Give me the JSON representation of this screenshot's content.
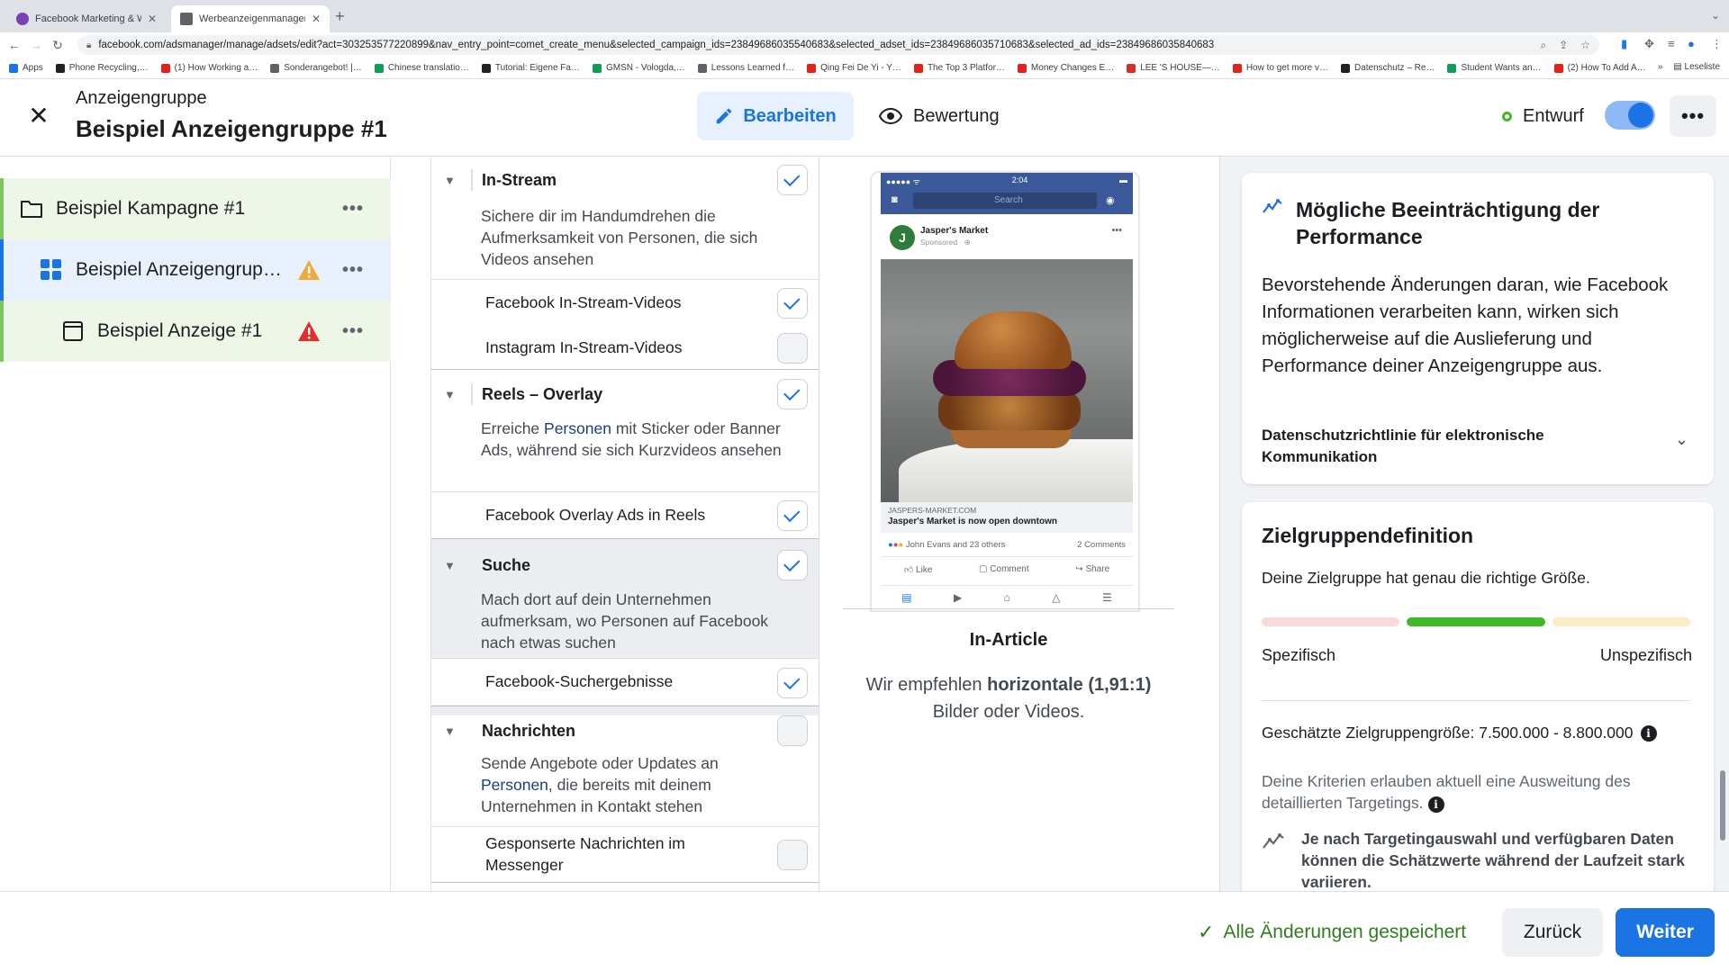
{
  "browser": {
    "tabs": [
      {
        "title": "Facebook Marketing & Werbe…",
        "active": false,
        "favicon_color": "#7b3fb7"
      },
      {
        "title": "Werbeanzeigenmanager - We…",
        "active": true,
        "favicon_color": "#5f6368"
      }
    ],
    "url": "facebook.com/adsmanager/manage/adsets/edit?act=303253577220899&nav_entry_point=comet_create_menu&selected_campaign_ids=23849686035540683&selected_adset_ids=23849686035710683&selected_ad_ids=23849686035840683",
    "bookmarks": [
      {
        "label": "Apps",
        "color": "#1a73e8"
      },
      {
        "label": "Phone Recycling,…",
        "color": "#202124"
      },
      {
        "label": "(1) How Working a…",
        "color": "#e62117"
      },
      {
        "label": "Sonderangebot! |…",
        "color": "#5f6368"
      },
      {
        "label": "Chinese translatio…",
        "color": "#0f9d58"
      },
      {
        "label": "Tutorial: Eigene Fa…",
        "color": "#202124"
      },
      {
        "label": "GMSN - Vologda,…",
        "color": "#0f9d58"
      },
      {
        "label": "Lessons Learned f…",
        "color": "#5f6368"
      },
      {
        "label": "Qing Fei De Yi - Y…",
        "color": "#e62117"
      },
      {
        "label": "The Top 3 Platfor…",
        "color": "#e62117"
      },
      {
        "label": "Money Changes E…",
        "color": "#e62117"
      },
      {
        "label": "LEE 'S HOUSE—…",
        "color": "#d93025"
      },
      {
        "label": "How to get more v…",
        "color": "#e62117"
      },
      {
        "label": "Datenschutz – Re…",
        "color": "#202124"
      },
      {
        "label": "Student Wants an…",
        "color": "#0f9d58"
      },
      {
        "label": "(2) How To Add A…",
        "color": "#e62117"
      }
    ],
    "reading_list": "Leseliste"
  },
  "header": {
    "subtitle": "Anzeigengruppe",
    "title": "Beispiel Anzeigengruppe #1",
    "edit_label": "Bearbeiten",
    "review_label": "Bewertung",
    "status_label": "Entwurf",
    "toggle_on": true
  },
  "sidebar": {
    "campaign": "Beispiel Kampagne #1",
    "adset": "Beispiel Anzeigengrup…",
    "ad": "Beispiel Anzeige #1"
  },
  "placements": {
    "instream": {
      "title": "In-Stream",
      "desc": "Sichere dir im Handumdrehen die Aufmerksamkeit von Personen, die sich Videos ansehen",
      "checked": true,
      "items": [
        {
          "label": "Facebook In-Stream-Videos",
          "checked": true
        },
        {
          "label": "Instagram In-Stream-Videos",
          "checked": false
        }
      ]
    },
    "reels": {
      "title": "Reels – Overlay",
      "desc_pre": "Erreiche ",
      "desc_link": "Personen",
      "desc_post": " mit Sticker oder Banner Ads, während sie sich Kurzvideos ansehen",
      "checked": true,
      "items": [
        {
          "label": "Facebook Overlay Ads in Reels",
          "checked": true
        }
      ]
    },
    "search": {
      "title": "Suche",
      "desc": "Mach dort auf dein Unternehmen aufmerksam, wo Personen auf Facebook nach etwas suchen",
      "checked": true,
      "items": [
        {
          "label": "Facebook-Suchergebnisse",
          "checked": true
        }
      ]
    },
    "messages": {
      "title": "Nachrichten",
      "desc_pre": "Sende Angebote oder Updates an ",
      "desc_link": "Personen",
      "desc_post": ", die bereits mit deinem Unternehmen in Kontakt stehen",
      "checked": false,
      "items": [
        {
          "label": "Gesponserte Nachrichten im Messenger",
          "checked": false
        }
      ]
    }
  },
  "preview": {
    "phone": {
      "time": "2:04",
      "search": "Search",
      "page_name": "Jasper's Market",
      "sponsored": "Sponsored · ",
      "link_url": "JASPERS-MARKET.COM",
      "link_headline": "Jasper's Market is now open downtown",
      "reactions": "John Evans and 23 others",
      "comments": "2 Comments",
      "like": "Like",
      "comment": "Comment",
      "share": "Share"
    },
    "title": "In-Article",
    "rec_pre": "Wir empfehlen ",
    "rec_bold": "horizontale (1,91:1)",
    "rec_post": " Bilder oder Videos."
  },
  "performance": {
    "title": "Mögliche Beeinträchtigung der Performance",
    "body": "Bevorstehende Änderungen daran, wie Facebook Informationen verarbeiten kann, wirken sich möglicherweise auf die Auslieferung und Performance deiner Anzeigengruppe aus.",
    "policy": "Datenschutzrichtlinie für elektronische Kommunikation"
  },
  "audience": {
    "title": "Zielgruppendefinition",
    "subtitle": "Deine Zielgruppe hat genau die richtige Größe.",
    "label_specific": "Spezifisch",
    "label_broad": "Unspezifisch",
    "meter_position": "middle",
    "meter_colors": [
      "#f9d9d9",
      "#42b72a",
      "#fbecc4"
    ],
    "size_text": "Geschätzte Zielgruppengröße: 7.500.000 - 8.800.000",
    "note": "Deine Kriterien erlauben aktuell eine Ausweitung des detaillierten Targetings.",
    "warning": "Je nach Targetingauswahl und verfügbaren Daten können die Schätzwerte während der Laufzeit stark variieren."
  },
  "footer": {
    "saved": "Alle Änderungen gespeichert",
    "back": "Zurück",
    "next": "Weiter"
  },
  "colors": {
    "accent": "#1b74e4",
    "success": "#42b72a",
    "warning": "#f2a93b",
    "error": "#e02f2f"
  }
}
